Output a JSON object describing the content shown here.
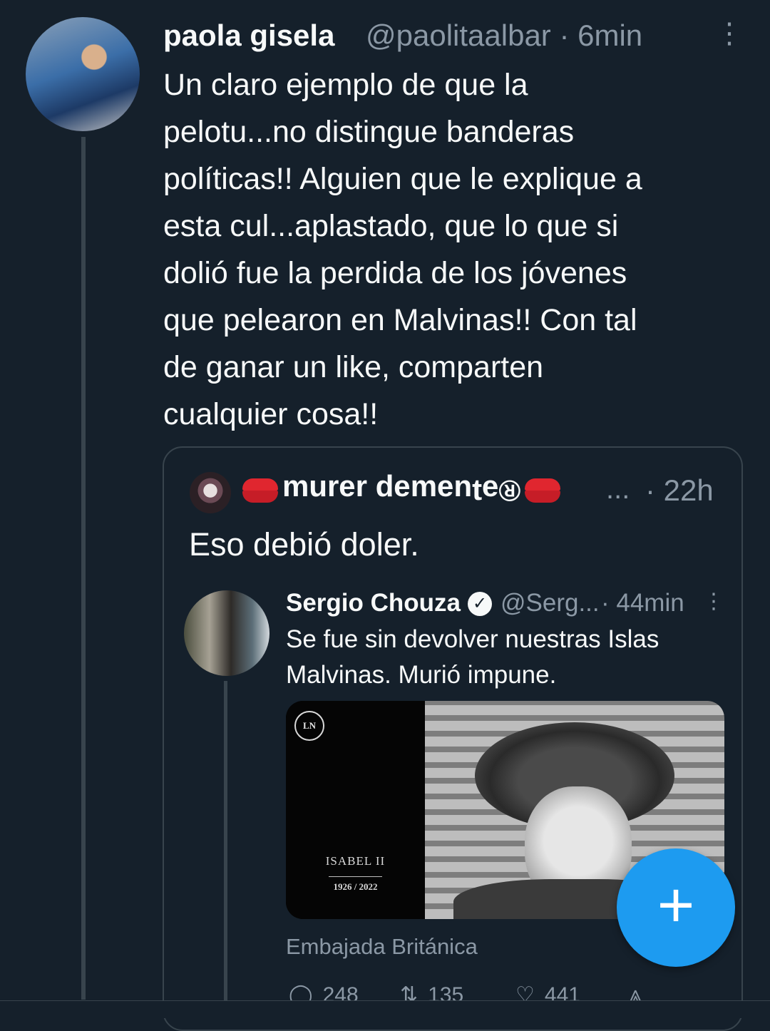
{
  "tweet": {
    "author_name": "paola gisela",
    "author_handle": "@paolitaalbar · 6min",
    "text": "Un claro ejemplo de que la\npelotu...no distingue banderas\npolíticas!! Alguien que le explique a\nesta cul...aplastado, que lo que si\ndolió fue la perdida de los jóvenes\nque pelearon en Malvinas!! Con tal\nde ganar un like, comparten\ncualquier cosa!!"
  },
  "quoted": {
    "author_name": "®ǝʇuǝɯǝp ɹǝɹnɯ",
    "ellipsis": "...",
    "time": "· 22h",
    "text": "Eso debió doler."
  },
  "inner": {
    "author_name": "Sergio Chouza",
    "author_handle": "@Serg...",
    "time": "· 44min",
    "text": "Se fue sin devolver nuestras Islas\nMalvinas. Murió impune.",
    "media": {
      "logo": "LN",
      "caption": "ISABEL II",
      "years": "1926 / 2022"
    },
    "source": "Embajada Británica",
    "actions": {
      "replies": "248",
      "retweets": "135",
      "likes": "441"
    }
  },
  "icons": {
    "more": "more-vertical-icon",
    "verified": "verified-badge-icon",
    "reply": "reply-icon",
    "retweet": "retweet-icon",
    "like": "heart-icon",
    "share": "share-icon",
    "compose": "plus-icon"
  },
  "colors": {
    "background": "#15202b",
    "text": "#f7f9f9",
    "secondary": "#8b98a5",
    "accent": "#1d9bf0"
  }
}
